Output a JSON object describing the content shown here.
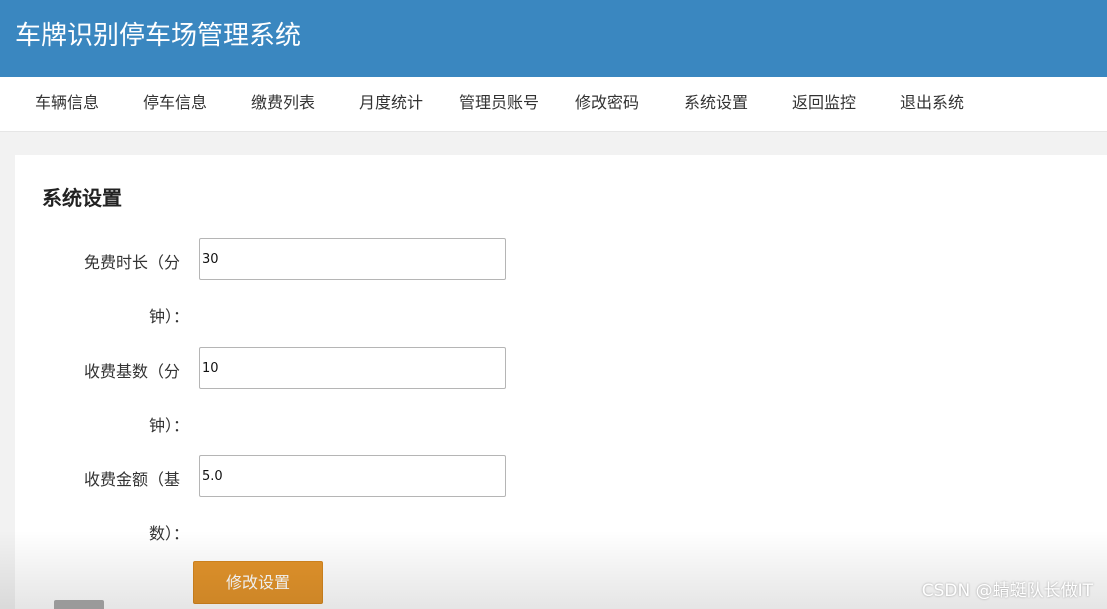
{
  "header": {
    "title": "车牌识别停车场管理系统"
  },
  "nav": {
    "items": [
      {
        "label": "车辆信息"
      },
      {
        "label": "停车信息"
      },
      {
        "label": "缴费列表"
      },
      {
        "label": "月度统计"
      },
      {
        "label": "管理员账号"
      },
      {
        "label": "修改密码"
      },
      {
        "label": "系统设置"
      },
      {
        "label": "返回监控"
      },
      {
        "label": "退出系统"
      }
    ]
  },
  "panel": {
    "title": "系统设置",
    "fields": [
      {
        "label_line1": "免费时长（分",
        "label_line2": "钟）：",
        "value": "30"
      },
      {
        "label_line1": "收费基数（分",
        "label_line2": "钟）：",
        "value": "10"
      },
      {
        "label_line1": "收费金额（基",
        "label_line2": "数）：",
        "value": "5.0"
      }
    ],
    "submit_label": "修改设置"
  },
  "watermark": "CSDN @蜻蜓队长做IT"
}
